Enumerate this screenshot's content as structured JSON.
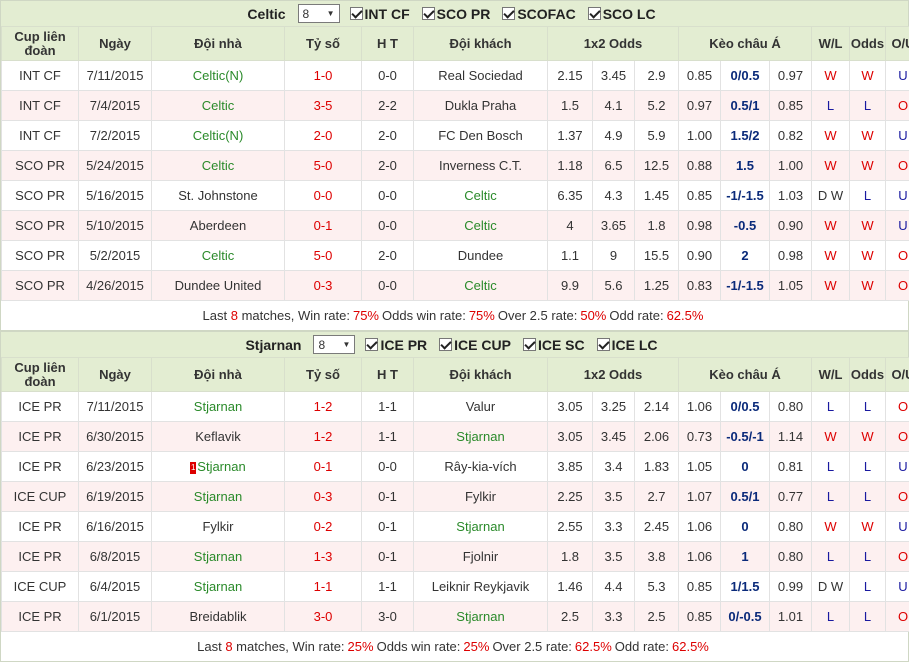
{
  "columns": {
    "league": "Cup liên đoàn",
    "date": "Ngày",
    "home": "Đội nhà",
    "score": "Tỷ số",
    "ht": "H T",
    "away": "Đội khách",
    "odds": "1x2 Odds",
    "asian": "Kèo châu Á",
    "wl": "W/L",
    "oddsres": "Odds",
    "ou": "O/U"
  },
  "sections": [
    {
      "team": "Celtic",
      "count": "8",
      "filters": [
        "INT CF",
        "SCO PR",
        "SCOFAC",
        "SCO LC"
      ],
      "rows": [
        {
          "league": "INT CF",
          "date": "7/11/2015",
          "home": "Celtic(N)",
          "home_hl": true,
          "score": "1-0",
          "ht": "0-0",
          "away": "Real Sociedad",
          "away_hl": false,
          "o1": "2.15",
          "ox": "3.45",
          "o2": "2.9",
          "a1": "0.85",
          "ah": "0/0.5",
          "a2": "0.97",
          "wl": "W",
          "od": "W",
          "ou": "U"
        },
        {
          "league": "INT CF",
          "date": "7/4/2015",
          "home": "Celtic",
          "home_hl": true,
          "score": "3-5",
          "ht": "2-2",
          "away": "Dukla Praha",
          "away_hl": false,
          "o1": "1.5",
          "ox": "4.1",
          "o2": "5.2",
          "a1": "0.97",
          "ah": "0.5/1",
          "a2": "0.85",
          "wl": "L",
          "od": "L",
          "ou": "O"
        },
        {
          "league": "INT CF",
          "date": "7/2/2015",
          "home": "Celtic(N)",
          "home_hl": true,
          "score": "2-0",
          "ht": "2-0",
          "away": "FC Den Bosch",
          "away_hl": false,
          "o1": "1.37",
          "ox": "4.9",
          "o2": "5.9",
          "a1": "1.00",
          "ah": "1.5/2",
          "a2": "0.82",
          "wl": "W",
          "od": "W",
          "ou": "U"
        },
        {
          "league": "SCO PR",
          "date": "5/24/2015",
          "home": "Celtic",
          "home_hl": true,
          "score": "5-0",
          "ht": "2-0",
          "away": "Inverness C.T.",
          "away_hl": false,
          "o1": "1.18",
          "ox": "6.5",
          "o2": "12.5",
          "a1": "0.88",
          "ah": "1.5",
          "a2": "1.00",
          "wl": "W",
          "od": "W",
          "ou": "O"
        },
        {
          "league": "SCO PR",
          "date": "5/16/2015",
          "home": "St. Johnstone",
          "home_hl": false,
          "score": "0-0",
          "ht": "0-0",
          "away": "Celtic",
          "away_hl": true,
          "o1": "6.35",
          "ox": "4.3",
          "o2": "1.45",
          "a1": "0.85",
          "ah": "-1/-1.5",
          "a2": "1.03",
          "wl": "D W",
          "od": "L",
          "ou": "U"
        },
        {
          "league": "SCO PR",
          "date": "5/10/2015",
          "home": "Aberdeen",
          "home_hl": false,
          "score": "0-1",
          "ht": "0-0",
          "away": "Celtic",
          "away_hl": true,
          "o1": "4",
          "ox": "3.65",
          "o2": "1.8",
          "a1": "0.98",
          "ah": "-0.5",
          "a2": "0.90",
          "wl": "W",
          "od": "W",
          "ou": "U"
        },
        {
          "league": "SCO PR",
          "date": "5/2/2015",
          "home": "Celtic",
          "home_hl": true,
          "score": "5-0",
          "ht": "2-0",
          "away": "Dundee",
          "away_hl": false,
          "o1": "1.1",
          "ox": "9",
          "o2": "15.5",
          "a1": "0.90",
          "ah": "2",
          "a2": "0.98",
          "wl": "W",
          "od": "W",
          "ou": "O"
        },
        {
          "league": "SCO PR",
          "date": "4/26/2015",
          "home": "Dundee United",
          "home_hl": false,
          "score": "0-3",
          "ht": "0-0",
          "away": "Celtic",
          "away_hl": true,
          "o1": "9.9",
          "ox": "5.6",
          "o2": "1.25",
          "a1": "0.83",
          "ah": "-1/-1.5",
          "a2": "1.05",
          "wl": "W",
          "od": "W",
          "ou": "O"
        }
      ],
      "summary": {
        "prefix": "Last",
        "count": "8",
        "matches": "matches, Win rate:",
        "win": "75%",
        "odds_label": "Odds win rate:",
        "odds": "75%",
        "over_label": "Over 2.5 rate:",
        "over": "50%",
        "odd_label": "Odd rate:",
        "odd": "62.5%"
      }
    },
    {
      "team": "Stjarnan",
      "count": "8",
      "filters": [
        "ICE PR",
        "ICE CUP",
        "ICE SC",
        "ICE LC"
      ],
      "rows": [
        {
          "league": "ICE PR",
          "date": "7/11/2015",
          "home": "Stjarnan",
          "home_hl": true,
          "score": "1-2",
          "ht": "1-1",
          "away": "Valur",
          "away_hl": false,
          "o1": "3.05",
          "ox": "3.25",
          "o2": "2.14",
          "a1": "1.06",
          "ah": "0/0.5",
          "a2": "0.80",
          "wl": "L",
          "od": "L",
          "ou": "O"
        },
        {
          "league": "ICE PR",
          "date": "6/30/2015",
          "home": "Keflavik",
          "home_hl": false,
          "score": "1-2",
          "ht": "1-1",
          "away": "Stjarnan",
          "away_hl": true,
          "o1": "3.05",
          "ox": "3.45",
          "o2": "2.06",
          "a1": "0.73",
          "ah": "-0.5/-1",
          "a2": "1.14",
          "wl": "W",
          "od": "W",
          "ou": "O"
        },
        {
          "league": "ICE PR",
          "date": "6/23/2015",
          "home": "Stjarnan",
          "home_hl": true,
          "home_flag": "1",
          "score": "0-1",
          "ht": "0-0",
          "away": "Rây-kia-vích",
          "away_hl": false,
          "o1": "3.85",
          "ox": "3.4",
          "o2": "1.83",
          "a1": "1.05",
          "ah": "0",
          "a2": "0.81",
          "wl": "L",
          "od": "L",
          "ou": "U"
        },
        {
          "league": "ICE CUP",
          "date": "6/19/2015",
          "home": "Stjarnan",
          "home_hl": true,
          "score": "0-3",
          "ht": "0-1",
          "away": "Fylkir",
          "away_hl": false,
          "o1": "2.25",
          "ox": "3.5",
          "o2": "2.7",
          "a1": "1.07",
          "ah": "0.5/1",
          "a2": "0.77",
          "wl": "L",
          "od": "L",
          "ou": "O"
        },
        {
          "league": "ICE PR",
          "date": "6/16/2015",
          "home": "Fylkir",
          "home_hl": false,
          "score": "0-2",
          "ht": "0-1",
          "away": "Stjarnan",
          "away_hl": true,
          "o1": "2.55",
          "ox": "3.3",
          "o2": "2.45",
          "a1": "1.06",
          "ah": "0",
          "a2": "0.80",
          "wl": "W",
          "od": "W",
          "ou": "U"
        },
        {
          "league": "ICE PR",
          "date": "6/8/2015",
          "home": "Stjarnan",
          "home_hl": true,
          "score": "1-3",
          "ht": "0-1",
          "away": "Fjolnir",
          "away_hl": false,
          "o1": "1.8",
          "ox": "3.5",
          "o2": "3.8",
          "a1": "1.06",
          "ah": "1",
          "a2": "0.80",
          "wl": "L",
          "od": "L",
          "ou": "O"
        },
        {
          "league": "ICE CUP",
          "date": "6/4/2015",
          "home": "Stjarnan",
          "home_hl": true,
          "score": "1-1",
          "ht": "1-1",
          "away": "Leiknir Reykjavik",
          "away_hl": false,
          "o1": "1.46",
          "ox": "4.4",
          "o2": "5.3",
          "a1": "0.85",
          "ah": "1/1.5",
          "a2": "0.99",
          "wl": "D W",
          "od": "L",
          "ou": "U"
        },
        {
          "league": "ICE PR",
          "date": "6/1/2015",
          "home": "Breidablik",
          "home_hl": false,
          "score": "3-0",
          "ht": "3-0",
          "away": "Stjarnan",
          "away_hl": true,
          "o1": "2.5",
          "ox": "3.3",
          "o2": "2.5",
          "a1": "0.85",
          "ah": "0/-0.5",
          "a2": "1.01",
          "wl": "L",
          "od": "L",
          "ou": "O"
        }
      ],
      "summary": {
        "prefix": "Last",
        "count": "8",
        "matches": "matches, Win rate:",
        "win": "25%",
        "odds_label": "Odds win rate:",
        "odds": "25%",
        "over_label": "Over 2.5 rate:",
        "over": "62.5%",
        "odd_label": "Odd rate:",
        "odd": "62.5%"
      }
    }
  ],
  "colors": {
    "header_bg": "#e3edd2",
    "alt_row": "#fdf0f0",
    "highlight_team": "#2a8a2a",
    "score": "#dd0000",
    "handicap": "#0a2a7a"
  }
}
